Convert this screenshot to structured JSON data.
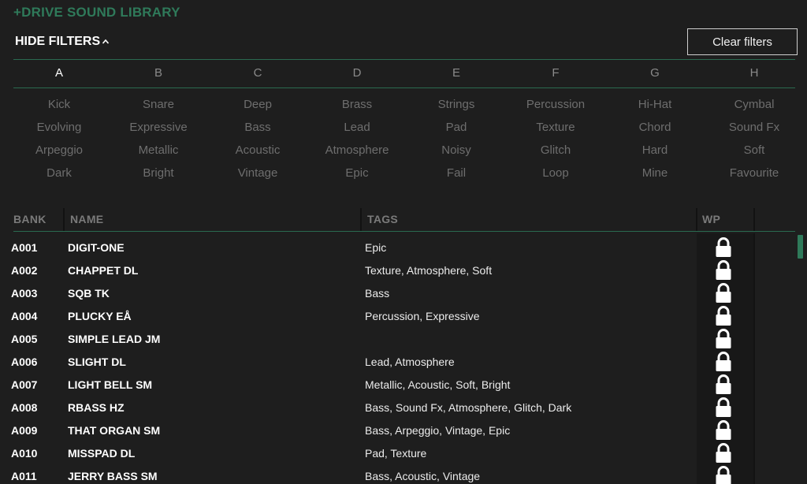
{
  "app": {
    "title": "+DRIVE SOUND LIBRARY"
  },
  "filters": {
    "toggle_label": "HIDE FILTERS",
    "clear_label": "Clear filters",
    "letters": [
      "A",
      "B",
      "C",
      "D",
      "E",
      "F",
      "G",
      "H"
    ],
    "active_letter": "A",
    "tag_rows": [
      [
        "Kick",
        "Snare",
        "Deep",
        "Brass",
        "Strings",
        "Percussion",
        "Hi-Hat",
        "Cymbal"
      ],
      [
        "Evolving",
        "Expressive",
        "Bass",
        "Lead",
        "Pad",
        "Texture",
        "Chord",
        "Sound Fx"
      ],
      [
        "Arpeggio",
        "Metallic",
        "Acoustic",
        "Atmosphere",
        "Noisy",
        "Glitch",
        "Hard",
        "Soft"
      ],
      [
        "Dark",
        "Bright",
        "Vintage",
        "Epic",
        "Fail",
        "Loop",
        "Mine",
        "Favourite"
      ]
    ]
  },
  "table": {
    "headers": {
      "bank": "BANK",
      "name": "NAME",
      "tags": "TAGS",
      "wp": "WP"
    },
    "rows": [
      {
        "bank": "A001",
        "name": "DIGIT-ONE",
        "tags": "Epic",
        "locked": true
      },
      {
        "bank": "A002",
        "name": "CHAPPET DL",
        "tags": "Texture, Atmosphere, Soft",
        "locked": true
      },
      {
        "bank": "A003",
        "name": "SQB TK",
        "tags": "Bass",
        "locked": true
      },
      {
        "bank": "A004",
        "name": "PLUCKY EÅ",
        "tags": "Percussion, Expressive",
        "locked": true
      },
      {
        "bank": "A005",
        "name": "SIMPLE LEAD JM",
        "tags": "",
        "locked": true
      },
      {
        "bank": "A006",
        "name": "SLIGHT DL",
        "tags": "Lead, Atmosphere",
        "locked": true
      },
      {
        "bank": "A007",
        "name": "LIGHT BELL SM",
        "tags": "Metallic, Acoustic, Soft, Bright",
        "locked": true
      },
      {
        "bank": "A008",
        "name": "RBASS HZ",
        "tags": "Bass, Sound Fx, Atmosphere, Glitch, Dark",
        "locked": true
      },
      {
        "bank": "A009",
        "name": "THAT ORGAN SM",
        "tags": "Bass, Arpeggio, Vintage, Epic",
        "locked": true
      },
      {
        "bank": "A010",
        "name": "MISSPAD DL",
        "tags": "Pad, Texture",
        "locked": true
      },
      {
        "bank": "A011",
        "name": "JERRY BASS SM",
        "tags": "Bass, Acoustic, Vintage",
        "locked": true
      }
    ]
  },
  "icons": {
    "lock": "lock-icon",
    "chevron": "chevron-up-icon"
  },
  "colors": {
    "accent": "#2f7a5a",
    "background": "#1e1e1e",
    "text": "#ffffff",
    "muted": "#6e6e6e"
  }
}
